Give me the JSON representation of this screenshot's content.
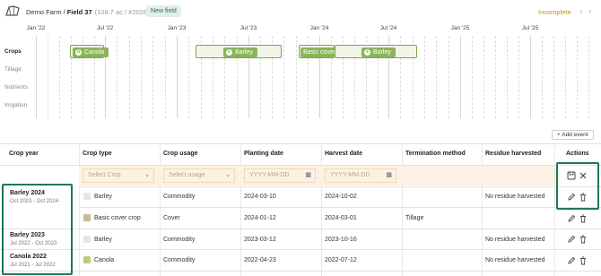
{
  "header": {
    "farm": "Demo Farm",
    "separator": "/",
    "field": "Field 37",
    "field_meta": "(108.7 ac / #202615)",
    "new_field_badge": "New field",
    "status": "Incomplete",
    "status_color": "#c98a1b",
    "prev_icon": "chevron-left-icon",
    "next_icon": "chevron-right-icon"
  },
  "timeline": {
    "date_labels": [
      "Jan '22",
      "Jul '22",
      "Jan '23",
      "Jul '23",
      "Jan '24",
      "Jul '24",
      "Jan '25",
      "Jul '25"
    ],
    "row_labels": [
      "Crops",
      "Tillage",
      "Nutrients",
      "Irrigation"
    ],
    "crop_bars": [
      {
        "label": "Canola",
        "icon": "canola-icon"
      },
      {
        "label": "Barley",
        "icon": "barley-icon"
      },
      {
        "label": "Basic cover crop",
        "icon": ""
      },
      {
        "label": "Barley",
        "icon": "barley-icon"
      }
    ]
  },
  "add_event": "+ Add event",
  "table": {
    "headers": [
      "Crop year",
      "Crop type",
      "Crop usage",
      "Planting date",
      "Harvest date",
      "Termination method",
      "Residue harvested",
      "Actions"
    ],
    "new_row": {
      "crop_placeholder": "Select Crop",
      "usage_placeholder": "Select usage",
      "planting_placeholder": "YYYY-MM-DD",
      "harvest_placeholder": "YYYY-MM-DD"
    },
    "years": [
      {
        "title": "Barley 2024",
        "range": "Oct 2023 - Oct 2024"
      },
      {
        "title": "Barley 2023",
        "range": "Jul 2022 - Oct 2023"
      },
      {
        "title": "Canola 2022",
        "range": "Jul 2021 - Jul 2022"
      }
    ],
    "rows": [
      {
        "crop": "Barley",
        "usage": "Commodity",
        "planting": "2024-03-10",
        "harvest": "2024-10-02",
        "termination": "",
        "residue": "No residue harvested"
      },
      {
        "crop": "Basic cover crop",
        "usage": "Cover",
        "planting": "2024-01-12",
        "harvest": "2024-03-01",
        "termination": "Tillage",
        "residue": ""
      },
      {
        "crop": "Barley",
        "usage": "Commodity",
        "planting": "2023-03-12",
        "harvest": "2023-10-16",
        "termination": "",
        "residue": "No residue harvested"
      },
      {
        "crop": "Canola",
        "usage": "Commodity",
        "planting": "2022-04-23",
        "harvest": "2022-07-12",
        "termination": "",
        "residue": "No residue harvested"
      }
    ]
  },
  "colors": {
    "accent_green": "#1f7a4e",
    "crop_green": "#8bb45a",
    "edit_row_bg": "#fdf1e3"
  }
}
